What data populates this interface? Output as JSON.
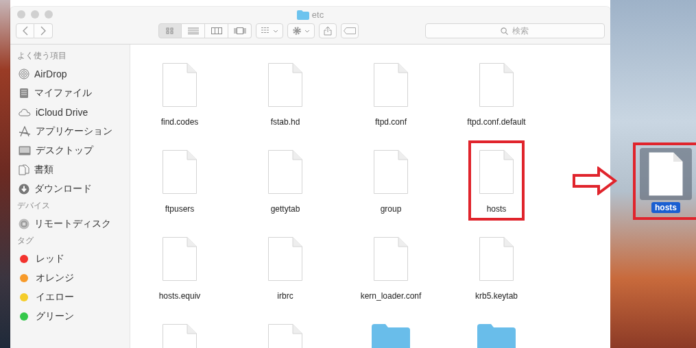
{
  "window": {
    "title": "etc"
  },
  "toolbar": {
    "view_buttons": [
      {
        "kind": "icons",
        "selected": true
      },
      {
        "kind": "list",
        "selected": false
      },
      {
        "kind": "columns",
        "selected": false
      },
      {
        "kind": "coverflow",
        "selected": false
      }
    ],
    "search": {
      "placeholder": "検索"
    }
  },
  "sidebar": [
    {
      "heading": "よく使う項目",
      "items": [
        {
          "label": "AirDrop",
          "kind": "airdrop"
        },
        {
          "label": "マイファイル",
          "kind": "files"
        },
        {
          "label": "iCloud Drive",
          "kind": "cloud"
        },
        {
          "label": "アプリケーション",
          "kind": "apps"
        },
        {
          "label": "デスクトップ",
          "kind": "desktop"
        },
        {
          "label": "書類",
          "kind": "documents"
        },
        {
          "label": "ダウンロード",
          "kind": "download"
        }
      ]
    },
    {
      "heading": "デバイス",
      "items": [
        {
          "label": "リモートディスク",
          "kind": "disk"
        }
      ]
    },
    {
      "heading": "タグ",
      "items": [
        {
          "label": "レッド",
          "kind": "tag",
          "color": "#f2332e"
        },
        {
          "label": "オレンジ",
          "kind": "tag",
          "color": "#f79a2a"
        },
        {
          "label": "イエロー",
          "kind": "tag",
          "color": "#f5cd2a"
        },
        {
          "label": "グリーン",
          "kind": "tag",
          "color": "#34c84a"
        }
      ]
    }
  ],
  "files": [
    {
      "name": "find.codes",
      "kind": "document",
      "highlighted": false
    },
    {
      "name": "fstab.hd",
      "kind": "document",
      "highlighted": false
    },
    {
      "name": "ftpd.conf",
      "kind": "document",
      "highlighted": false
    },
    {
      "name": "ftpd.conf.default",
      "kind": "document",
      "highlighted": false
    },
    {
      "name": "ftpusers",
      "kind": "document",
      "highlighted": false
    },
    {
      "name": "gettytab",
      "kind": "document",
      "highlighted": false
    },
    {
      "name": "group",
      "kind": "document",
      "highlighted": false
    },
    {
      "name": "hosts",
      "kind": "document",
      "highlighted": true
    },
    {
      "name": "hosts.equiv",
      "kind": "document",
      "highlighted": false
    },
    {
      "name": "irbrc",
      "kind": "document",
      "highlighted": false
    },
    {
      "name": "kern_loader.conf",
      "kind": "document",
      "highlighted": false
    },
    {
      "name": "krb5.keytab",
      "kind": "document",
      "highlighted": false
    },
    {
      "kind": "document",
      "highlighted": false
    },
    {
      "kind": "document",
      "highlighted": false
    },
    {
      "kind": "folder",
      "highlighted": false
    },
    {
      "kind": "folder",
      "highlighted": false
    }
  ],
  "desktop": {
    "file": {
      "name": "hosts",
      "kind": "document",
      "selected": true,
      "highlighted": true
    }
  }
}
